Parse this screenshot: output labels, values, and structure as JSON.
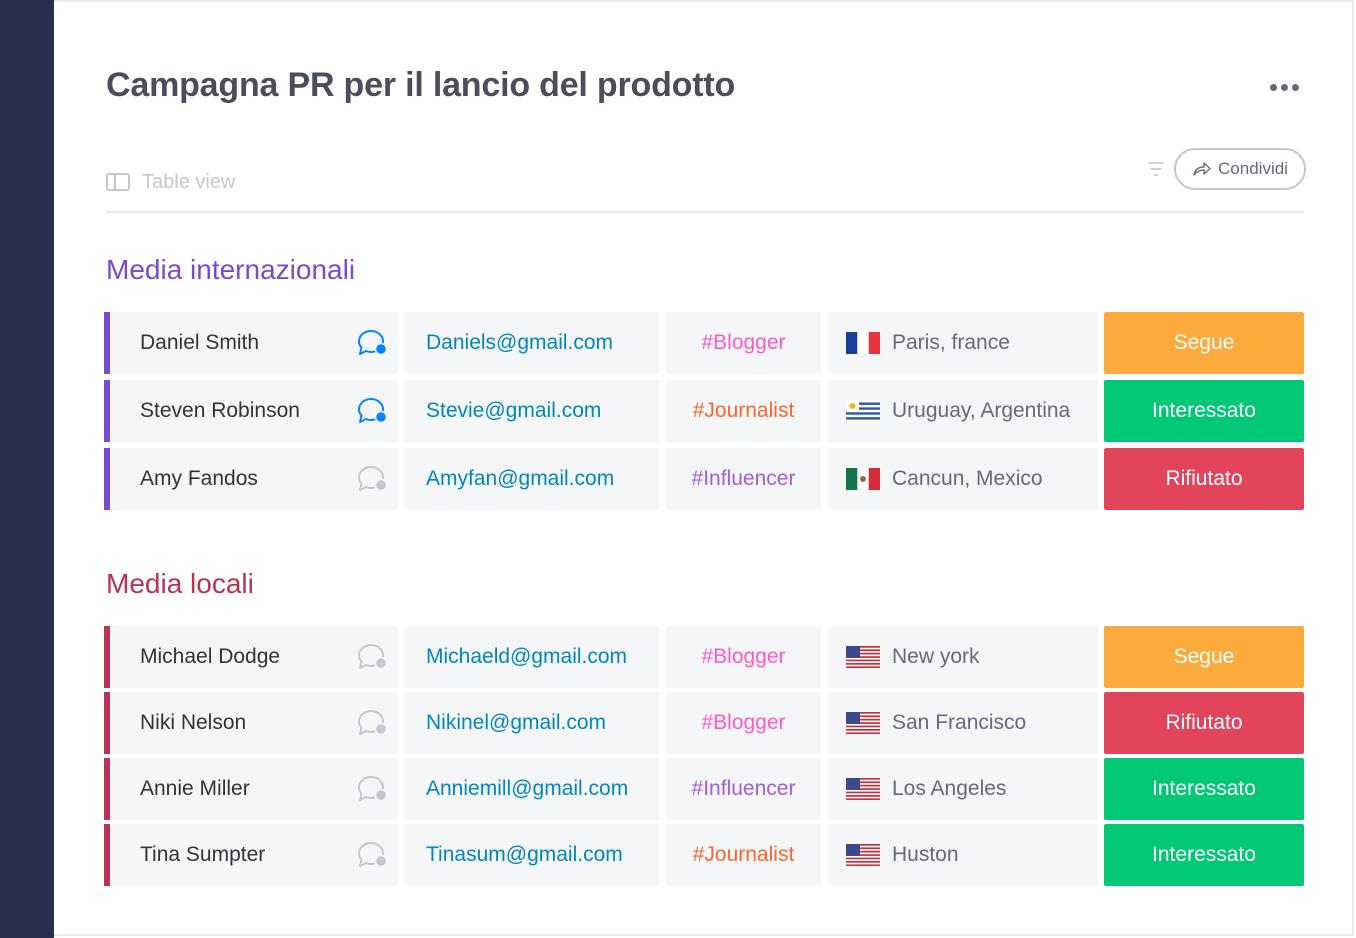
{
  "header": {
    "title": "Campagna PR per il lancio del prodotto"
  },
  "toolbar": {
    "view_label": "Table view",
    "share_label": "Condividi"
  },
  "colors": {
    "sidebar": "#292f4c",
    "group_internazionali": "#784bd1",
    "group_locali": "#bb3354",
    "email": "#0086c0",
    "status_segue": "#fdab3d",
    "status_interessato": "#00c875",
    "status_rifiutato": "#e2445c",
    "tag_blogger": "#ff5ac4",
    "tag_journalist": "#ff642e",
    "tag_influencer": "#a25ddc"
  },
  "groups": [
    {
      "title": "Media internazionali",
      "rows": [
        {
          "name": "Daniel Smith",
          "chat": "active",
          "email": "Daniels@gmail.com",
          "tag": "#Blogger",
          "flag": "fr-flag-icon",
          "location": "Paris, france",
          "status": "Segue"
        },
        {
          "name": "Steven Robinson",
          "chat": "active",
          "email": "Stevie@gmail.com",
          "tag": "#Journalist",
          "flag": "uy-flag-icon",
          "location": "Uruguay, Argentina",
          "status": "Interessato"
        },
        {
          "name": "Amy Fandos",
          "chat": "inactive",
          "email": "Amyfan@gmail.com",
          "tag": "#Influencer",
          "flag": "mx-flag-icon",
          "location": "Cancun, Mexico",
          "status": "Rifiutato"
        }
      ]
    },
    {
      "title": "Media locali",
      "rows": [
        {
          "name": "Michael Dodge",
          "chat": "inactive",
          "email": "Michaeld@gmail.com",
          "tag": "#Blogger",
          "flag": "us-flag-icon",
          "location": "New york",
          "status": "Segue"
        },
        {
          "name": "Niki Nelson",
          "chat": "inactive",
          "email": "Nikinel@gmail.com",
          "tag": "#Blogger",
          "flag": "us-flag-icon",
          "location": "San Francisco",
          "status": "Rifiutato"
        },
        {
          "name": "Annie Miller",
          "chat": "inactive",
          "email": "Anniemill@gmail.com",
          "tag": "#Influencer",
          "flag": "us-flag-icon",
          "location": "Los Angeles",
          "status": "Interessato"
        },
        {
          "name": "Tina Sumpter",
          "chat": "inactive",
          "email": "Tinasum@gmail.com",
          "tag": "#Journalist",
          "flag": "us-flag-icon",
          "location": "Huston",
          "status": "Interessato"
        }
      ]
    }
  ]
}
